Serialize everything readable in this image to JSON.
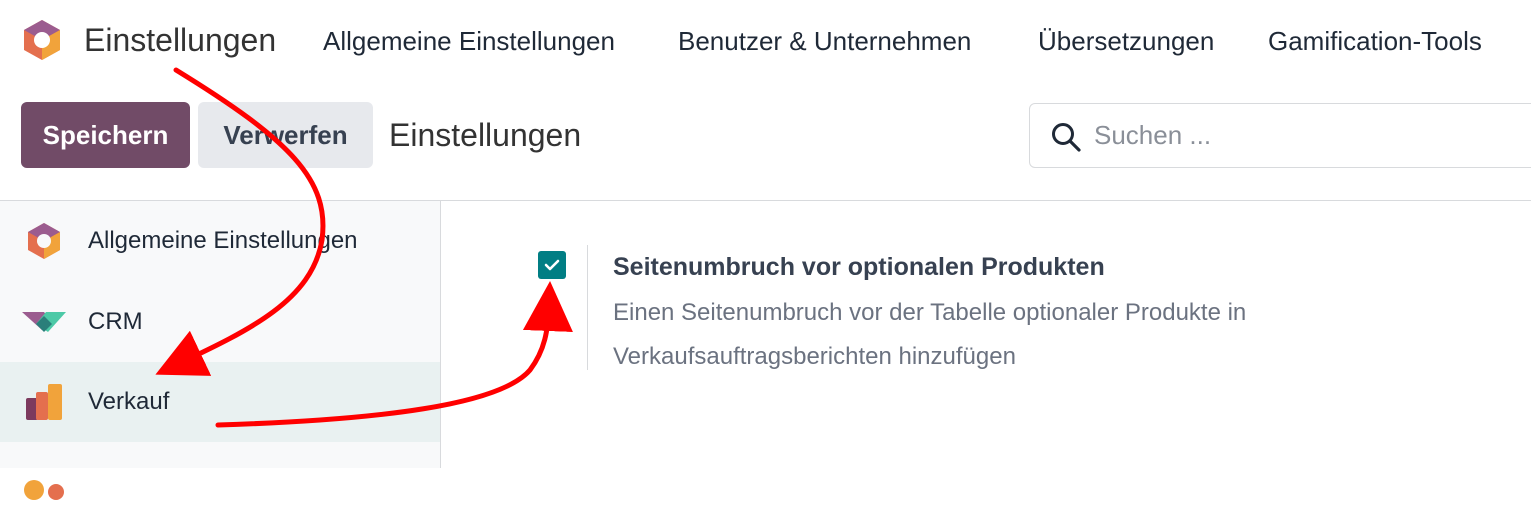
{
  "topbar": {
    "app_title": "Einstellungen",
    "menu": [
      "Allgemeine Einstellungen",
      "Benutzer & Unternehmen",
      "Übersetzungen",
      "Gamification-Tools"
    ]
  },
  "control_panel": {
    "save_label": "Speichern",
    "discard_label": "Verwerfen",
    "breadcrumb": "Einstellungen",
    "search_placeholder": "Suchen ..."
  },
  "sidebar": {
    "items": [
      {
        "label": "Allgemeine Einstellungen",
        "icon": "settings-app-icon",
        "active": false
      },
      {
        "label": "CRM",
        "icon": "crm-app-icon",
        "active": false
      },
      {
        "label": "Verkauf",
        "icon": "sales-app-icon",
        "active": true
      }
    ]
  },
  "setting": {
    "checked": true,
    "title": "Seitenumbruch vor optionalen Produkten",
    "description": "Einen Seitenumbruch vor der Tabelle optionaler Produkte in Verkaufsauftragsberichten hinzufügen"
  },
  "colors": {
    "primary": "#714b67",
    "accent": "#017e84",
    "annotation_arrow": "#ff0000"
  }
}
